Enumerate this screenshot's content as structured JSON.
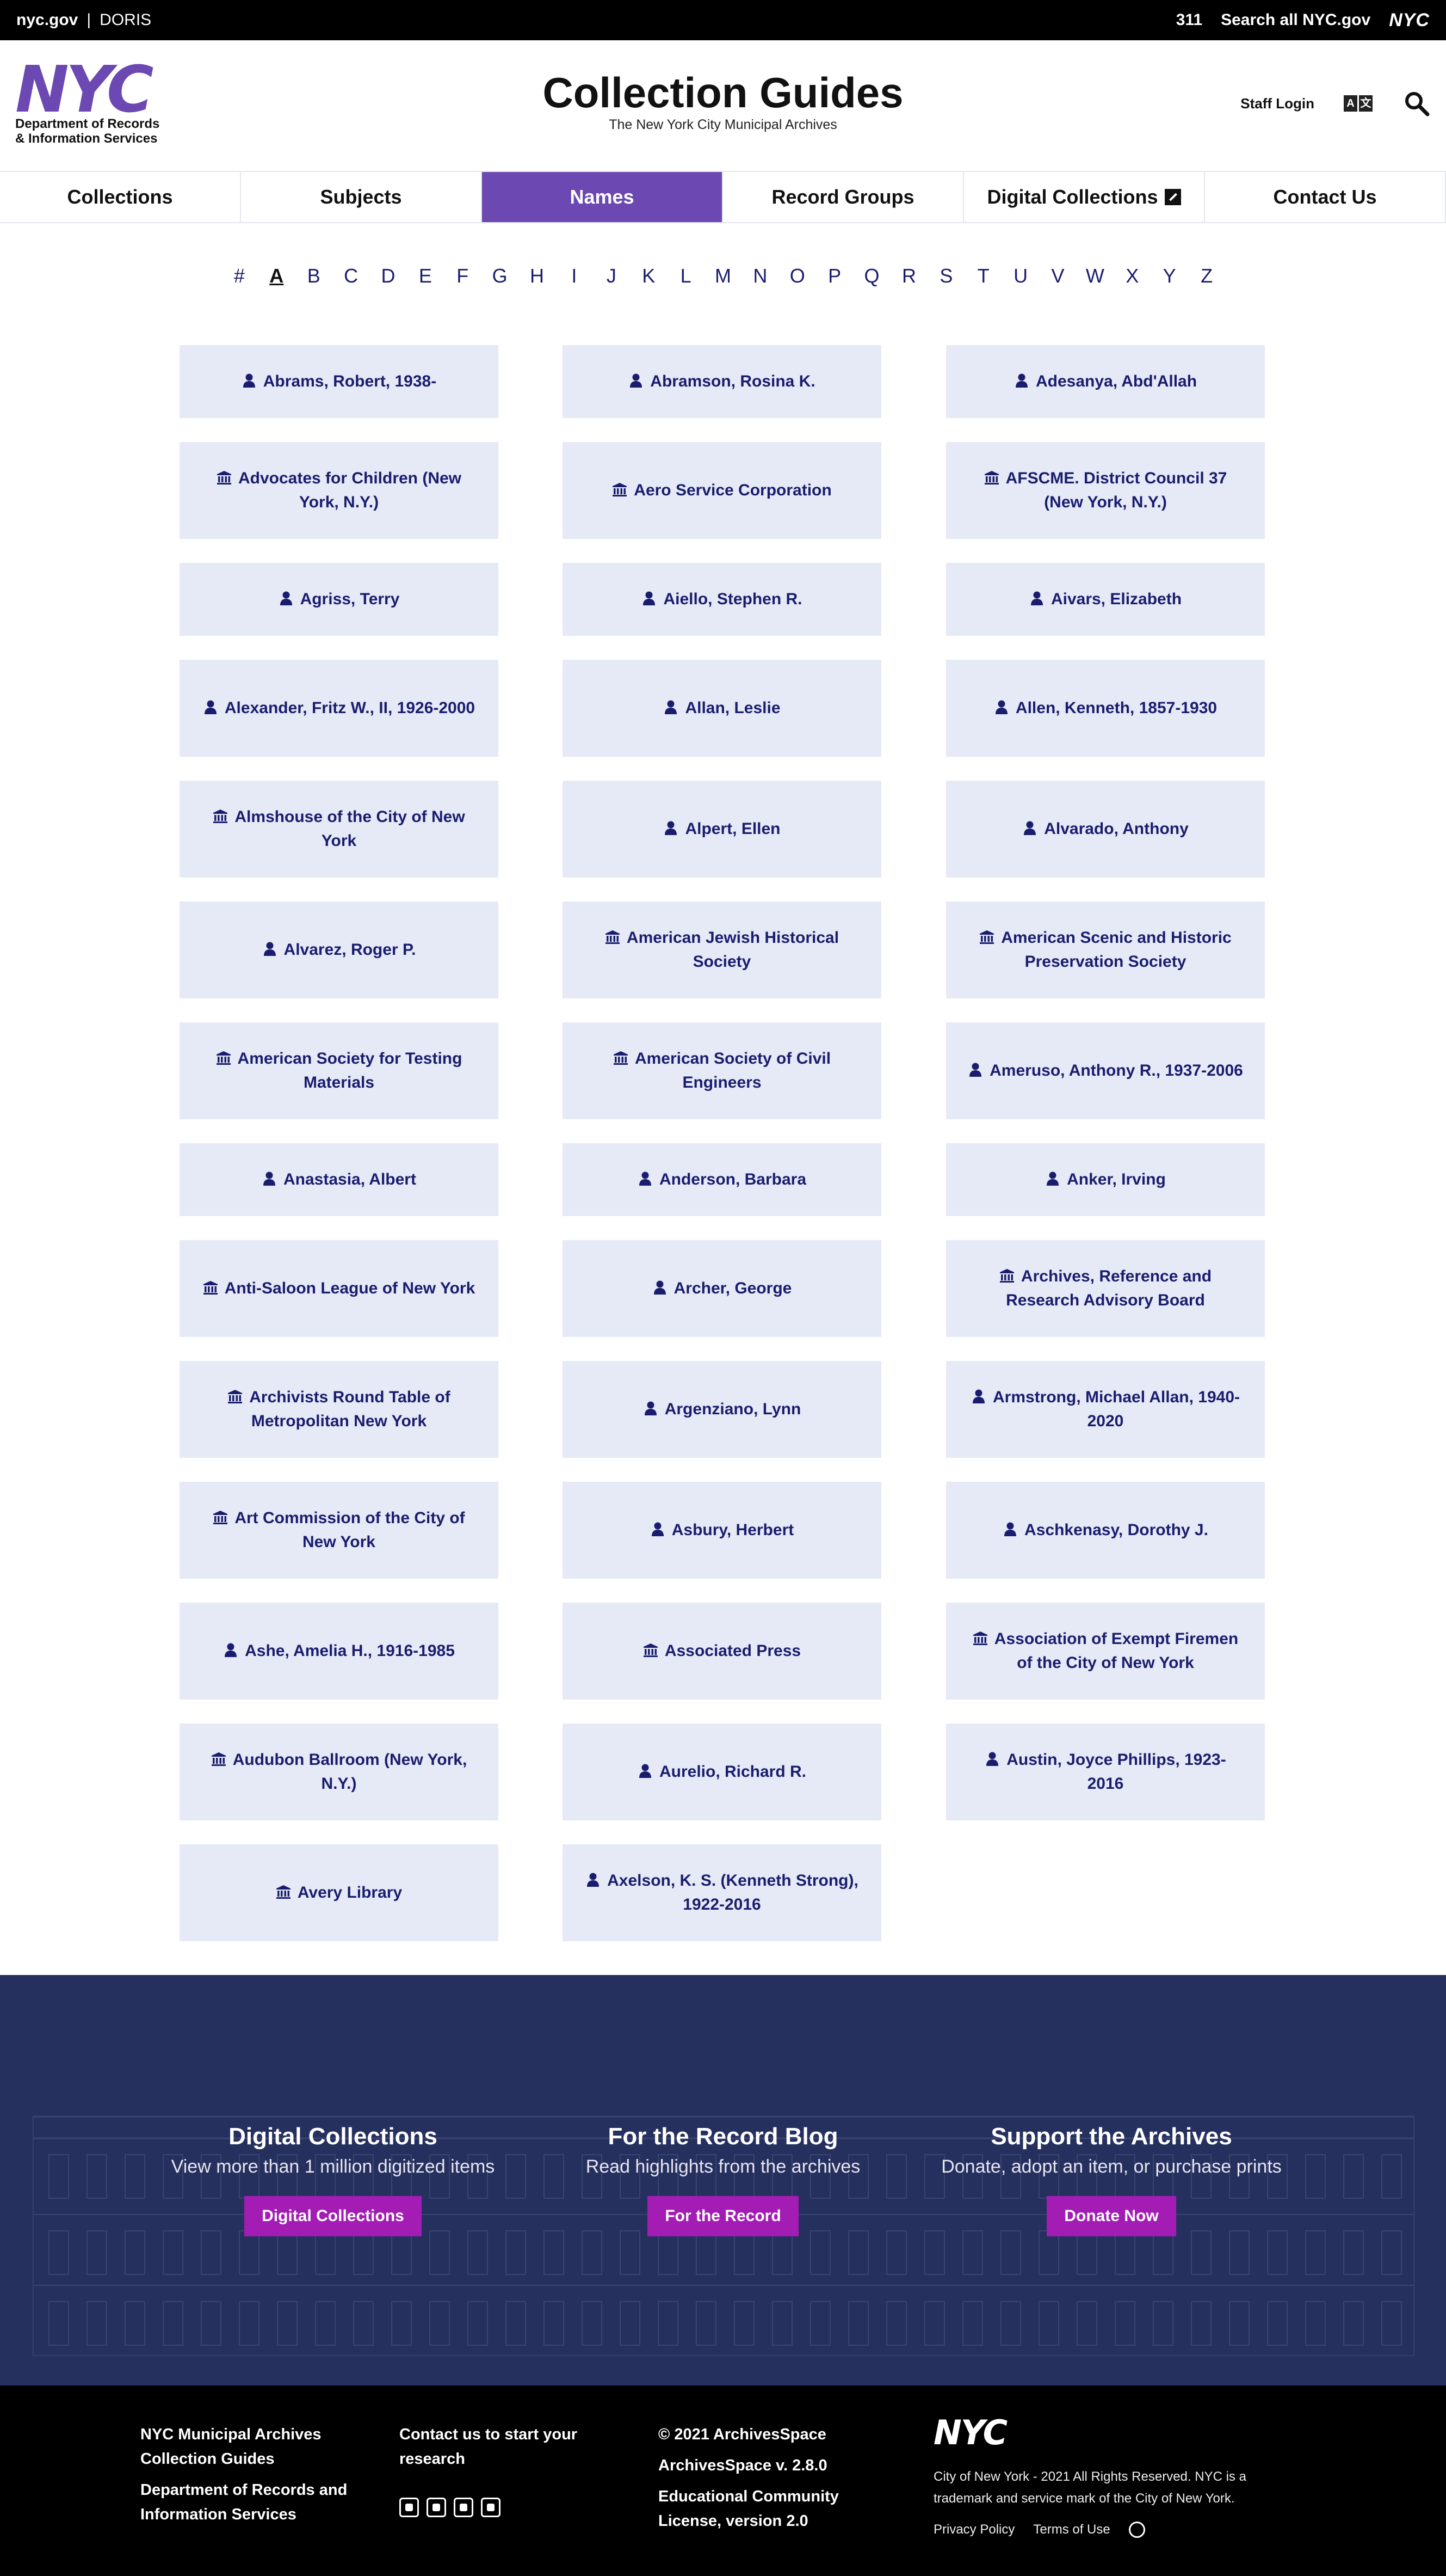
{
  "topbar": {
    "nycgov": "nyc.gov",
    "separator": "|",
    "doris": "DORIS",
    "link_311": "311",
    "search_all": "Search all NYC.gov",
    "nyc_mark": "NYC"
  },
  "header": {
    "logo_mark": "NYC",
    "logo_line1": "Department of Records",
    "logo_line2": "& Information Services",
    "title": "Collection Guides",
    "subtitle": "The New York City Municipal Archives",
    "staff_login": "Staff Login",
    "lang_icon_a": "A",
    "lang_icon_b": "文"
  },
  "nav": {
    "tabs": [
      {
        "label": "Collections"
      },
      {
        "label": "Subjects"
      },
      {
        "label": "Names"
      },
      {
        "label": "Record Groups"
      },
      {
        "label": "Digital Collections"
      },
      {
        "label": "Contact Us"
      }
    ],
    "active_tab": "Names",
    "accent_color": "#6b48b2"
  },
  "alphabet": {
    "letters": [
      "#",
      "A",
      "B",
      "C",
      "D",
      "E",
      "F",
      "G",
      "H",
      "I",
      "J",
      "K",
      "L",
      "M",
      "N",
      "O",
      "P",
      "Q",
      "R",
      "S",
      "T",
      "U",
      "V",
      "W",
      "X",
      "Y",
      "Z"
    ],
    "active_letter": "A"
  },
  "names": [
    {
      "label": "Abrams, Robert, 1938-",
      "icon": "person-icon"
    },
    {
      "label": "Abramson, Rosina K.",
      "icon": "person-icon"
    },
    {
      "label": "Adesanya, Abd'Allah",
      "icon": "person-icon"
    },
    {
      "label": "Advocates for Children (New York, N.Y.)",
      "icon": "institution-icon"
    },
    {
      "label": "Aero Service Corporation",
      "icon": "institution-icon"
    },
    {
      "label": "AFSCME. District Council 37 (New York, N.Y.)",
      "icon": "institution-icon"
    },
    {
      "label": "Agriss, Terry",
      "icon": "person-icon"
    },
    {
      "label": "Aiello, Stephen R.",
      "icon": "person-icon"
    },
    {
      "label": "Aivars, Elizabeth",
      "icon": "person-icon"
    },
    {
      "label": "Alexander, Fritz W., II, 1926-2000",
      "icon": "person-icon"
    },
    {
      "label": "Allan, Leslie",
      "icon": "person-icon"
    },
    {
      "label": "Allen, Kenneth, 1857-1930",
      "icon": "person-icon"
    },
    {
      "label": "Almshouse of the City of New York",
      "icon": "institution-icon"
    },
    {
      "label": "Alpert, Ellen",
      "icon": "person-icon"
    },
    {
      "label": "Alvarado, Anthony",
      "icon": "person-icon"
    },
    {
      "label": "Alvarez, Roger P.",
      "icon": "person-icon"
    },
    {
      "label": "American Jewish Historical Society",
      "icon": "institution-icon"
    },
    {
      "label": "American Scenic and Historic Preservation Society",
      "icon": "institution-icon"
    },
    {
      "label": "American Society for Testing Materials",
      "icon": "institution-icon"
    },
    {
      "label": "American Society of Civil Engineers",
      "icon": "institution-icon"
    },
    {
      "label": "Ameruso, Anthony R., 1937-2006",
      "icon": "person-icon"
    },
    {
      "label": "Anastasia, Albert",
      "icon": "person-icon"
    },
    {
      "label": "Anderson, Barbara",
      "icon": "person-icon"
    },
    {
      "label": "Anker, Irving",
      "icon": "person-icon"
    },
    {
      "label": "Anti-Saloon League of New York",
      "icon": "institution-icon"
    },
    {
      "label": "Archer, George",
      "icon": "person-icon"
    },
    {
      "label": "Archives, Reference and Research Advisory Board",
      "icon": "institution-icon"
    },
    {
      "label": "Archivists Round Table of Metropolitan New York",
      "icon": "institution-icon"
    },
    {
      "label": "Argenziano, Lynn",
      "icon": "person-icon"
    },
    {
      "label": "Armstrong, Michael Allan, 1940-2020",
      "icon": "person-icon"
    },
    {
      "label": "Art Commission of the City of New York",
      "icon": "institution-icon"
    },
    {
      "label": "Asbury, Herbert",
      "icon": "person-icon"
    },
    {
      "label": "Aschkenasy, Dorothy J.",
      "icon": "person-icon"
    },
    {
      "label": "Ashe, Amelia H., 1916-1985",
      "icon": "person-icon"
    },
    {
      "label": "Associated Press",
      "icon": "institution-icon"
    },
    {
      "label": "Association of Exempt Firemen of the City of New York",
      "icon": "institution-icon"
    },
    {
      "label": "Audubon Ballroom (New York, N.Y.)",
      "icon": "institution-icon"
    },
    {
      "label": "Aurelio, Richard R.",
      "icon": "person-icon"
    },
    {
      "label": "Austin, Joyce Phillips, 1923-2016",
      "icon": "person-icon"
    },
    {
      "label": "Avery Library",
      "icon": "institution-icon"
    },
    {
      "label": "Axelson, K. S. (Kenneth Strong), 1922-2016",
      "icon": "person-icon"
    }
  ],
  "promo": {
    "digital": {
      "heading": "Digital Collections",
      "text": "View more than 1 million digitized items",
      "button": "Digital Collections"
    },
    "blog": {
      "heading": "For the Record Blog",
      "text": "Read highlights from the archives",
      "button": "For the Record"
    },
    "support": {
      "heading": "Support the Archives",
      "text": "Donate, adopt an item, or purchase prints",
      "button": "Donate Now"
    },
    "button_color": "#a31cb4",
    "background_color": "#26305e"
  },
  "footer": {
    "col1_line1": "NYC Municipal Archives",
    "col1_line2": "Collection Guides",
    "col1_line3": "Department of Records and",
    "col1_line4": "Information Services",
    "col2_line1": "Contact us to start your",
    "col2_line2": "research",
    "social_icons": [
      "twitter-icon",
      "facebook-icon",
      "instagram-icon",
      "youtube-icon"
    ],
    "col3_line1": "© 2021 ArchivesSpace",
    "col3_line2": "ArchivesSpace v. 2.8.0",
    "col3_line3": "Educational Community",
    "col3_line4": "License, version 2.0",
    "nyc_mark": "NYC",
    "legal_line1": "City of New York - 2021 All Rights Reserved. NYC is a",
    "legal_line2": "trademark and service mark of the City of New York.",
    "privacy": "Privacy Policy",
    "terms": "Terms of Use"
  }
}
